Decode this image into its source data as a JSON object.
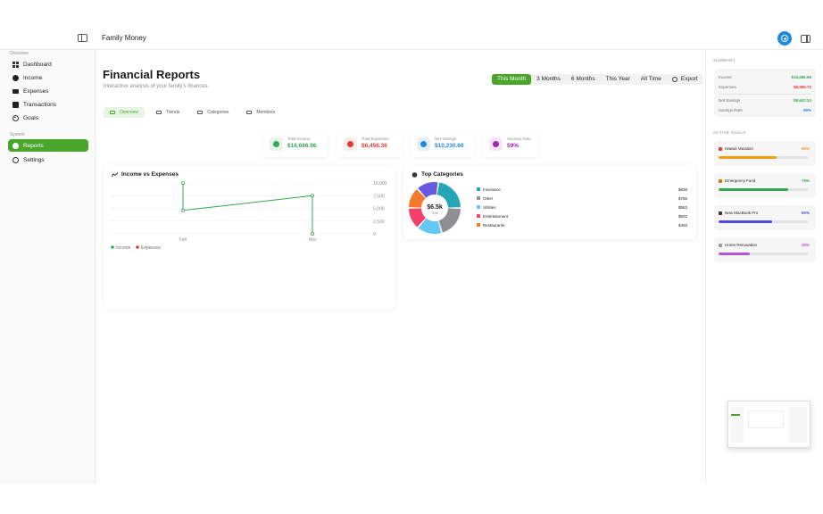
{
  "app": {
    "title": "Family Money"
  },
  "sidebar": {
    "overview_label": "Overview",
    "system_label": "System",
    "items": [
      {
        "label": "Dashboard",
        "icon": "dashboard-icon"
      },
      {
        "label": "Income",
        "icon": "income-icon"
      },
      {
        "label": "Expenses",
        "icon": "expenses-icon"
      },
      {
        "label": "Transactions",
        "icon": "transactions-icon"
      },
      {
        "label": "Goals",
        "icon": "goals-icon"
      }
    ],
    "system_items": [
      {
        "label": "Reports",
        "icon": "reports-icon",
        "active": true
      },
      {
        "label": "Settings",
        "icon": "settings-icon"
      }
    ]
  },
  "header": {
    "title": "Financial Reports",
    "subtitle": "Interactive analysis of your family's finances.",
    "ranges": [
      "This Month",
      "3 Months",
      "6 Months",
      "This Year",
      "All Time"
    ],
    "active_range": "This Month",
    "export_label": "Export"
  },
  "tabs": [
    {
      "label": "Overview",
      "active": true
    },
    {
      "label": "Trends"
    },
    {
      "label": "Categories"
    },
    {
      "label": "Members"
    }
  ],
  "kpis": [
    {
      "label": "Total Income",
      "value": "$16,686.96",
      "color": "#34a853",
      "bg": "#e6f4ea"
    },
    {
      "label": "Total Expenses",
      "value": "$6,456.36",
      "color": "#e53935",
      "bg": "#fdecea"
    },
    {
      "label": "Net Savings",
      "value": "$10,230.60",
      "color": "#1e88e5",
      "bg": "#e3f0fc"
    },
    {
      "label": "Savings Rate",
      "value": "59%",
      "color": "#9c27b0",
      "bg": "#f5e6f8"
    }
  ],
  "income_chart": {
    "title": "Income vs Expenses",
    "legend_income": "Income",
    "legend_expenses": "Expenses"
  },
  "chart_data": {
    "type": "line",
    "title": "Income vs Expenses",
    "categories": [
      "Feb",
      "Mar"
    ],
    "y_ticks": [
      "10,000",
      "7,500",
      "5,000",
      "2,500",
      "0"
    ],
    "ylim": [
      0,
      10000
    ],
    "series": [
      {
        "name": "Income",
        "color": "#34a853",
        "values": [
          4600,
          7500
        ]
      },
      {
        "name": "Expenses",
        "color": "#e53935",
        "values": [
          0,
          0
        ]
      }
    ]
  },
  "categories_chart": {
    "title": "Top Categories",
    "center_value": "$6.5k",
    "center_label": "Total",
    "items": [
      {
        "name": "Insurance",
        "amount": "$836",
        "value": 836,
        "color": "#26a4b8"
      },
      {
        "name": "Other",
        "amount": "$755",
        "value": 755,
        "color": "#8e8e93"
      },
      {
        "name": "Utilities",
        "amount": "$583",
        "value": 583,
        "color": "#64c8f2"
      },
      {
        "name": "Entertainment",
        "amount": "$502",
        "value": 502,
        "color": "#f23f6b"
      },
      {
        "name": "Restaurants",
        "amount": "$493",
        "value": 493,
        "color": "#f5792a"
      }
    ],
    "extra_slices": [
      {
        "value": 520,
        "color": "#6a5ae0"
      }
    ]
  },
  "summary": {
    "label": "SUMMARY",
    "rows": [
      {
        "key": "Income",
        "value": "$16,686.96",
        "color": "#34a853"
      },
      {
        "key": "Expenses",
        "value": "$6,856.72",
        "color": "#e53935"
      },
      {
        "key": "Net Savings",
        "value": "$9,647.24",
        "color": "#34a853"
      },
      {
        "key": "Savings Rate",
        "value": "59%",
        "color": "#1e88e5"
      }
    ]
  },
  "goals": {
    "label": "ACTIVE GOALS",
    "items": [
      {
        "name": "Hawaii Vacation",
        "pct": "65%",
        "progress": 0.65,
        "color": "#f59e0b",
        "icon_color": "#e53935"
      },
      {
        "name": "Emergency Fund",
        "pct": "78%",
        "progress": 0.78,
        "color": "#34a853",
        "icon_color": "#d97706"
      },
      {
        "name": "New MacBook Pro",
        "pct": "60%",
        "progress": 0.6,
        "color": "#4f46e5",
        "icon_color": "#333333"
      },
      {
        "name": "Home Renovation",
        "pct": "35%",
        "progress": 0.35,
        "color": "#b455d6",
        "icon_color": "#999999"
      }
    ]
  }
}
